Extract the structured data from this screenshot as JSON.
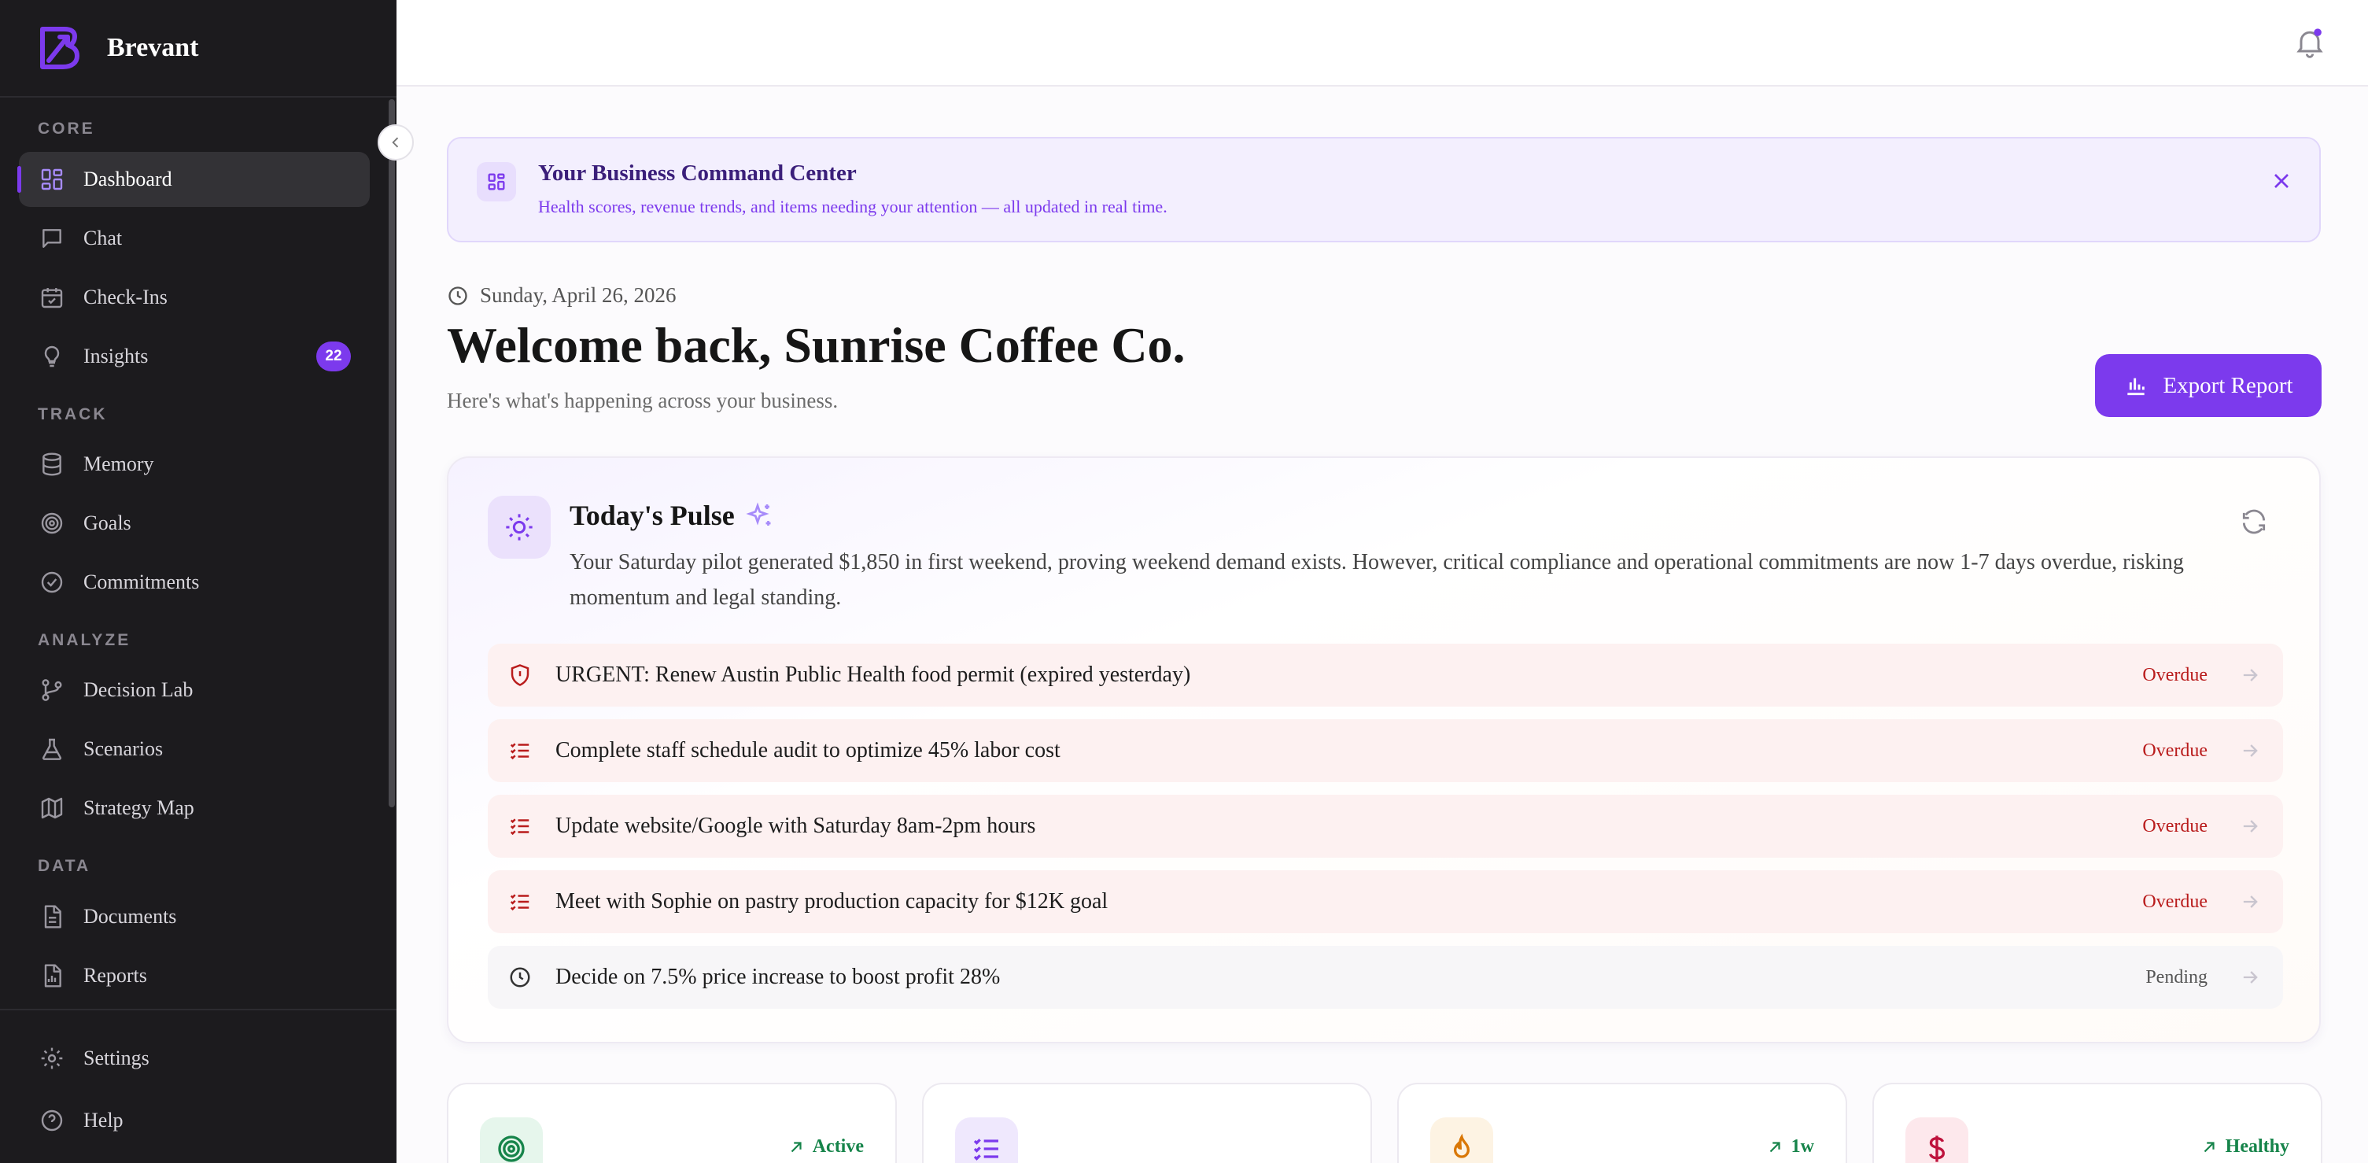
{
  "brand": {
    "name": "Brevant"
  },
  "sidebar": {
    "sections": {
      "core": "CORE",
      "track": "TRACK",
      "analyze": "ANALYZE",
      "data": "DATA"
    },
    "items": [
      {
        "label": "Dashboard",
        "icon": "dashboard-icon"
      },
      {
        "label": "Chat",
        "icon": "chat-icon"
      },
      {
        "label": "Check-Ins",
        "icon": "calendar-check-icon"
      },
      {
        "label": "Insights",
        "icon": "lightbulb-icon",
        "badge": "22"
      },
      {
        "label": "Memory",
        "icon": "database-icon"
      },
      {
        "label": "Goals",
        "icon": "target-icon"
      },
      {
        "label": "Commitments",
        "icon": "check-circle-icon"
      },
      {
        "label": "Decision Lab",
        "icon": "branch-icon"
      },
      {
        "label": "Scenarios",
        "icon": "flask-icon"
      },
      {
        "label": "Strategy Map",
        "icon": "map-icon"
      },
      {
        "label": "Documents",
        "icon": "document-icon"
      },
      {
        "label": "Reports",
        "icon": "report-icon"
      },
      {
        "label": "Settings",
        "icon": "gear-icon"
      },
      {
        "label": "Help",
        "icon": "help-icon"
      }
    ]
  },
  "banner": {
    "title": "Your Business Command Center",
    "subtitle": "Health scores, revenue trends, and items needing your attention — all updated in real time."
  },
  "header": {
    "date": "Sunday, April 26, 2026",
    "welcome": "Welcome back, Sunrise Coffee Co.",
    "subtitle": "Here's what's happening across your business.",
    "export_label": "Export Report"
  },
  "pulse": {
    "title": "Today's Pulse",
    "summary": "Your Saturday pilot generated $1,850 in first weekend, proving weekend demand exists. However, critical compliance and operational commitments are now 1-7 days overdue, risking momentum and legal standing.",
    "tasks": [
      {
        "label": "URGENT: Renew Austin Public Health food permit (expired yesterday)",
        "status": "Overdue",
        "icon": "shield-alert-icon"
      },
      {
        "label": "Complete staff schedule audit to optimize 45% labor cost",
        "status": "Overdue",
        "icon": "list-check-icon"
      },
      {
        "label": "Update website/Google with Saturday 8am-2pm hours",
        "status": "Overdue",
        "icon": "list-check-icon"
      },
      {
        "label": "Meet with Sophie on pastry production capacity for $12K goal",
        "status": "Overdue",
        "icon": "list-check-icon"
      },
      {
        "label": "Decide on 7.5% price increase to boost profit 28%",
        "status": "Pending",
        "icon": "clock-icon"
      }
    ]
  },
  "metrics": [
    {
      "icon": "target-icon",
      "tag": "Active",
      "color": "#16844a",
      "bg": "#e6f6ec"
    },
    {
      "icon": "list-check-icon",
      "tag": "",
      "color": "#7c3aed",
      "bg": "#efe8fd"
    },
    {
      "icon": "flame-icon",
      "tag": "1w",
      "color": "#d97706",
      "bg": "#fdf3e3"
    },
    {
      "icon": "dollar-icon",
      "tag": "Healthy",
      "color": "#be123c",
      "bg": "#fde8ec"
    }
  ],
  "colors": {
    "accent": "#7c3aed",
    "overdue": "#b91c1c",
    "positive": "#16844a",
    "sidebar": "#1c1b1e"
  }
}
